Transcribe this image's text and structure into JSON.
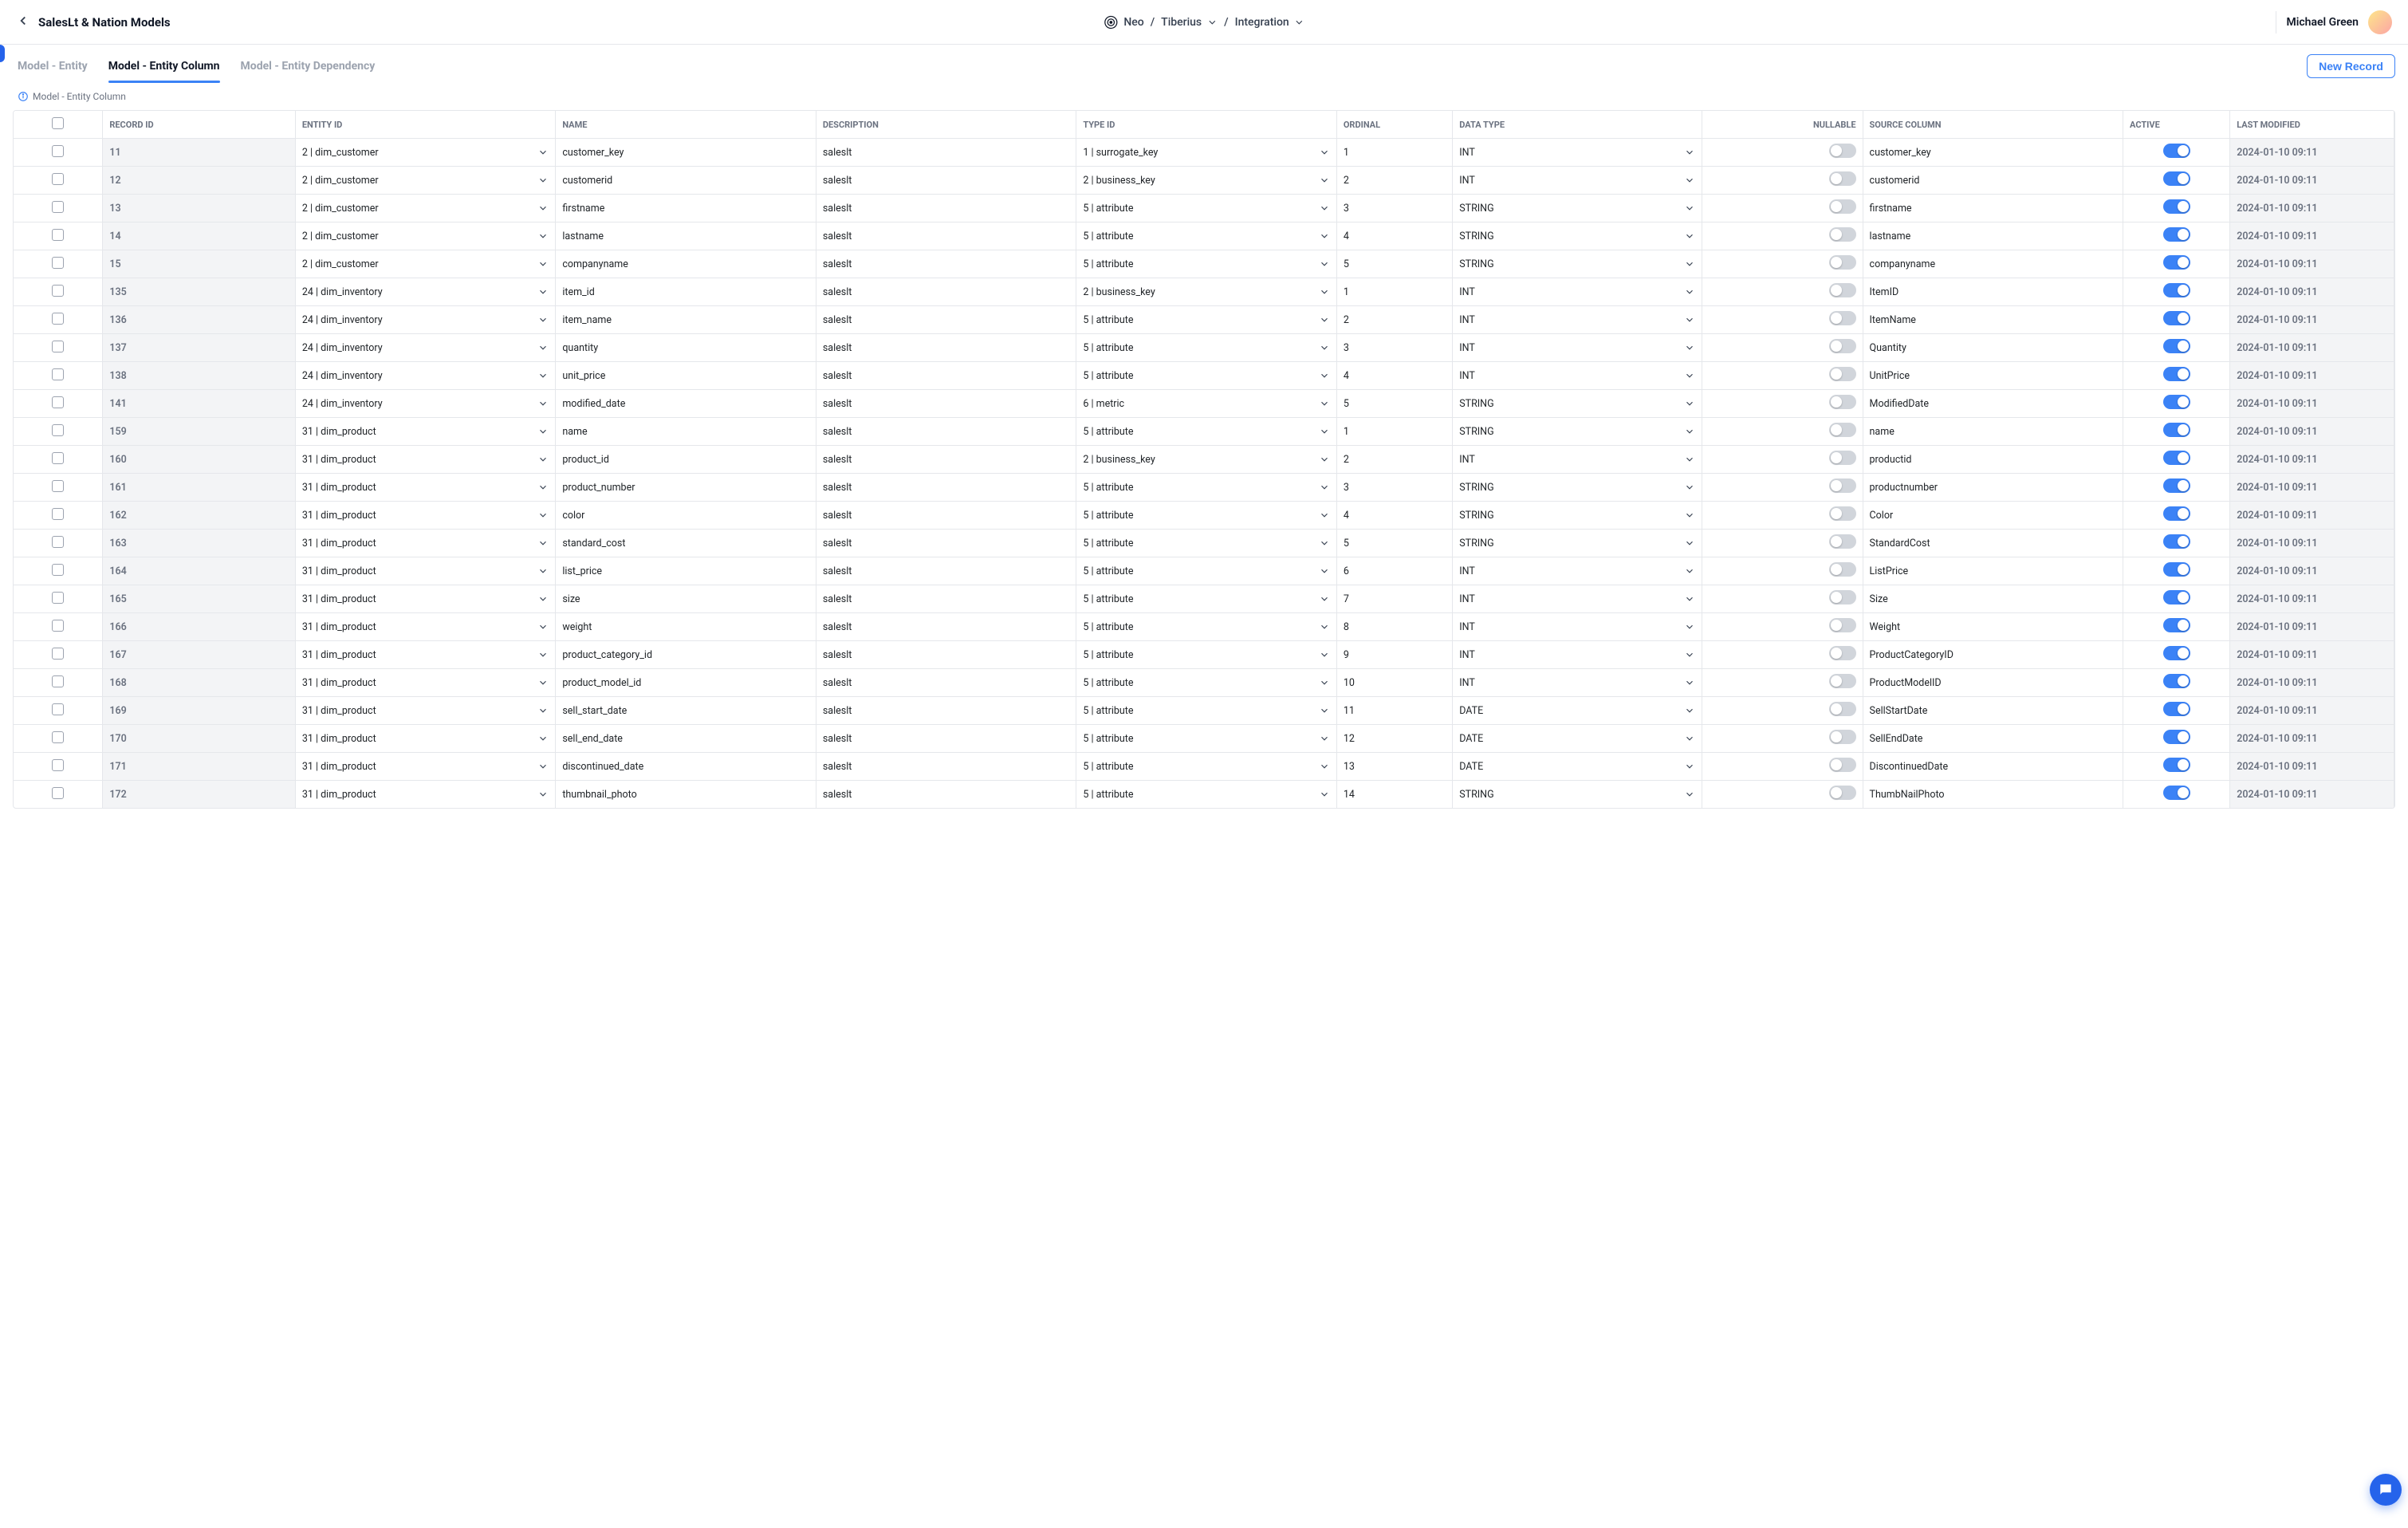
{
  "header": {
    "title": "SalesLt & Nation Models",
    "breadcrumb": {
      "root": "Neo",
      "project": "Tiberius",
      "section": "Integration"
    },
    "user": "Michael Green"
  },
  "tabs": [
    {
      "label": "Model - Entity",
      "active": false
    },
    {
      "label": "Model - Entity Column",
      "active": true
    },
    {
      "label": "Model - Entity Dependency",
      "active": false
    }
  ],
  "new_record_label": "New Record",
  "crumb_label": "Model - Entity Column",
  "columns": [
    "RECORD ID",
    "ENTITY ID",
    "NAME",
    "DESCRIPTION",
    "TYPE ID",
    "ORDINAL",
    "DATA TYPE",
    "NULLABLE",
    "SOURCE COLUMN",
    "ACTIVE",
    "LAST MODIFIED"
  ],
  "rows": [
    {
      "record_id": "11",
      "entity_id": "2 | dim_customer",
      "name": "customer_key",
      "description": "saleslt",
      "type_id": "1 | surrogate_key",
      "ordinal": "1",
      "data_type": "INT",
      "nullable": false,
      "source_column": "customer_key",
      "active": true,
      "last_modified": "2024-01-10 09:11"
    },
    {
      "record_id": "12",
      "entity_id": "2 | dim_customer",
      "name": "customerid",
      "description": "saleslt",
      "type_id": "2 | business_key",
      "ordinal": "2",
      "data_type": "INT",
      "nullable": false,
      "source_column": "customerid",
      "active": true,
      "last_modified": "2024-01-10 09:11"
    },
    {
      "record_id": "13",
      "entity_id": "2 | dim_customer",
      "name": "firstname",
      "description": "saleslt",
      "type_id": "5 | attribute",
      "ordinal": "3",
      "data_type": "STRING",
      "nullable": false,
      "source_column": "firstname",
      "active": true,
      "last_modified": "2024-01-10 09:11"
    },
    {
      "record_id": "14",
      "entity_id": "2 | dim_customer",
      "name": "lastname",
      "description": "saleslt",
      "type_id": "5 | attribute",
      "ordinal": "4",
      "data_type": "STRING",
      "nullable": false,
      "source_column": "lastname",
      "active": true,
      "last_modified": "2024-01-10 09:11"
    },
    {
      "record_id": "15",
      "entity_id": "2 | dim_customer",
      "name": "companyname",
      "description": "saleslt",
      "type_id": "5 | attribute",
      "ordinal": "5",
      "data_type": "STRING",
      "nullable": false,
      "source_column": "companyname",
      "active": true,
      "last_modified": "2024-01-10 09:11"
    },
    {
      "record_id": "135",
      "entity_id": "24 | dim_inventory",
      "name": "item_id",
      "description": "saleslt",
      "type_id": "2 | business_key",
      "ordinal": "1",
      "data_type": "INT",
      "nullable": false,
      "source_column": "ItemID",
      "active": true,
      "last_modified": "2024-01-10 09:11"
    },
    {
      "record_id": "136",
      "entity_id": "24 | dim_inventory",
      "name": "item_name",
      "description": "saleslt",
      "type_id": "5 | attribute",
      "ordinal": "2",
      "data_type": "INT",
      "nullable": false,
      "source_column": "ItemName",
      "active": true,
      "last_modified": "2024-01-10 09:11"
    },
    {
      "record_id": "137",
      "entity_id": "24 | dim_inventory",
      "name": "quantity",
      "description": "saleslt",
      "type_id": "5 | attribute",
      "ordinal": "3",
      "data_type": "INT",
      "nullable": false,
      "source_column": "Quantity",
      "active": true,
      "last_modified": "2024-01-10 09:11"
    },
    {
      "record_id": "138",
      "entity_id": "24 | dim_inventory",
      "name": "unit_price",
      "description": "saleslt",
      "type_id": "5 | attribute",
      "ordinal": "4",
      "data_type": "INT",
      "nullable": false,
      "source_column": "UnitPrice",
      "active": true,
      "last_modified": "2024-01-10 09:11"
    },
    {
      "record_id": "141",
      "entity_id": "24 | dim_inventory",
      "name": "modified_date",
      "description": "saleslt",
      "type_id": "6 | metric",
      "ordinal": "5",
      "data_type": "STRING",
      "nullable": false,
      "source_column": "ModifiedDate",
      "active": true,
      "last_modified": "2024-01-10 09:11"
    },
    {
      "record_id": "159",
      "entity_id": "31 | dim_product",
      "name": "name",
      "description": "saleslt",
      "type_id": "5 | attribute",
      "ordinal": "1",
      "data_type": "STRING",
      "nullable": false,
      "source_column": "name",
      "active": true,
      "last_modified": "2024-01-10 09:11"
    },
    {
      "record_id": "160",
      "entity_id": "31 | dim_product",
      "name": "product_id",
      "description": "saleslt",
      "type_id": "2 | business_key",
      "ordinal": "2",
      "data_type": "INT",
      "nullable": false,
      "source_column": "productid",
      "active": true,
      "last_modified": "2024-01-10 09:11"
    },
    {
      "record_id": "161",
      "entity_id": "31 | dim_product",
      "name": "product_number",
      "description": "saleslt",
      "type_id": "5 | attribute",
      "ordinal": "3",
      "data_type": "STRING",
      "nullable": false,
      "source_column": "productnumber",
      "active": true,
      "last_modified": "2024-01-10 09:11"
    },
    {
      "record_id": "162",
      "entity_id": "31 | dim_product",
      "name": "color",
      "description": "saleslt",
      "type_id": "5 | attribute",
      "ordinal": "4",
      "data_type": "STRING",
      "nullable": false,
      "source_column": "Color",
      "active": true,
      "last_modified": "2024-01-10 09:11"
    },
    {
      "record_id": "163",
      "entity_id": "31 | dim_product",
      "name": "standard_cost",
      "description": "saleslt",
      "type_id": "5 | attribute",
      "ordinal": "5",
      "data_type": "STRING",
      "nullable": false,
      "source_column": "StandardCost",
      "active": true,
      "last_modified": "2024-01-10 09:11"
    },
    {
      "record_id": "164",
      "entity_id": "31 | dim_product",
      "name": "list_price",
      "description": "saleslt",
      "type_id": "5 | attribute",
      "ordinal": "6",
      "data_type": "INT",
      "nullable": false,
      "source_column": "ListPrice",
      "active": true,
      "last_modified": "2024-01-10 09:11"
    },
    {
      "record_id": "165",
      "entity_id": "31 | dim_product",
      "name": "size",
      "description": "saleslt",
      "type_id": "5 | attribute",
      "ordinal": "7",
      "data_type": "INT",
      "nullable": false,
      "source_column": "Size",
      "active": true,
      "last_modified": "2024-01-10 09:11"
    },
    {
      "record_id": "166",
      "entity_id": "31 | dim_product",
      "name": "weight",
      "description": "saleslt",
      "type_id": "5 | attribute",
      "ordinal": "8",
      "data_type": "INT",
      "nullable": false,
      "source_column": "Weight",
      "active": true,
      "last_modified": "2024-01-10 09:11"
    },
    {
      "record_id": "167",
      "entity_id": "31 | dim_product",
      "name": "product_category_id",
      "description": "saleslt",
      "type_id": "5 | attribute",
      "ordinal": "9",
      "data_type": "INT",
      "nullable": false,
      "source_column": "ProductCategoryID",
      "active": true,
      "last_modified": "2024-01-10 09:11"
    },
    {
      "record_id": "168",
      "entity_id": "31 | dim_product",
      "name": "product_model_id",
      "description": "saleslt",
      "type_id": "5 | attribute",
      "ordinal": "10",
      "data_type": "INT",
      "nullable": false,
      "source_column": "ProductModelID",
      "active": true,
      "last_modified": "2024-01-10 09:11"
    },
    {
      "record_id": "169",
      "entity_id": "31 | dim_product",
      "name": "sell_start_date",
      "description": "saleslt",
      "type_id": "5 | attribute",
      "ordinal": "11",
      "data_type": "DATE",
      "nullable": false,
      "source_column": "SellStartDate",
      "active": true,
      "last_modified": "2024-01-10 09:11"
    },
    {
      "record_id": "170",
      "entity_id": "31 | dim_product",
      "name": "sell_end_date",
      "description": "saleslt",
      "type_id": "5 | attribute",
      "ordinal": "12",
      "data_type": "DATE",
      "nullable": false,
      "source_column": "SellEndDate",
      "active": true,
      "last_modified": "2024-01-10 09:11"
    },
    {
      "record_id": "171",
      "entity_id": "31 | dim_product",
      "name": "discontinued_date",
      "description": "saleslt",
      "type_id": "5 | attribute",
      "ordinal": "13",
      "data_type": "DATE",
      "nullable": false,
      "source_column": "DiscontinuedDate",
      "active": true,
      "last_modified": "2024-01-10 09:11"
    },
    {
      "record_id": "172",
      "entity_id": "31 | dim_product",
      "name": "thumbnail_photo",
      "description": "saleslt",
      "type_id": "5 | attribute",
      "ordinal": "14",
      "data_type": "STRING",
      "nullable": false,
      "source_column": "ThumbNailPhoto",
      "active": true,
      "last_modified": "2024-01-10 09:11"
    }
  ]
}
